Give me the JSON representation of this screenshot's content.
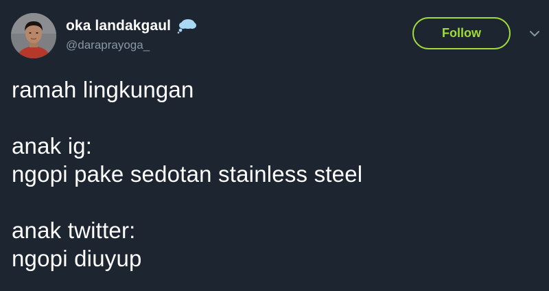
{
  "user": {
    "display_name": "oka landakgaul",
    "handle": "@daraprayoga_",
    "badge_icon": "cloud-icon"
  },
  "actions": {
    "follow_label": "Follow",
    "menu_icon": "chevron-down-icon"
  },
  "tweet": {
    "lines": [
      "ramah lingkungan",
      "",
      "anak ig:",
      "ngopi pake sedotan stainless steel",
      "",
      "anak twitter:",
      "ngopi diuyup"
    ]
  },
  "colors": {
    "background": "#1c2530",
    "accent": "#9fdc3a",
    "handle": "#8899a6",
    "text": "#ffffff"
  }
}
